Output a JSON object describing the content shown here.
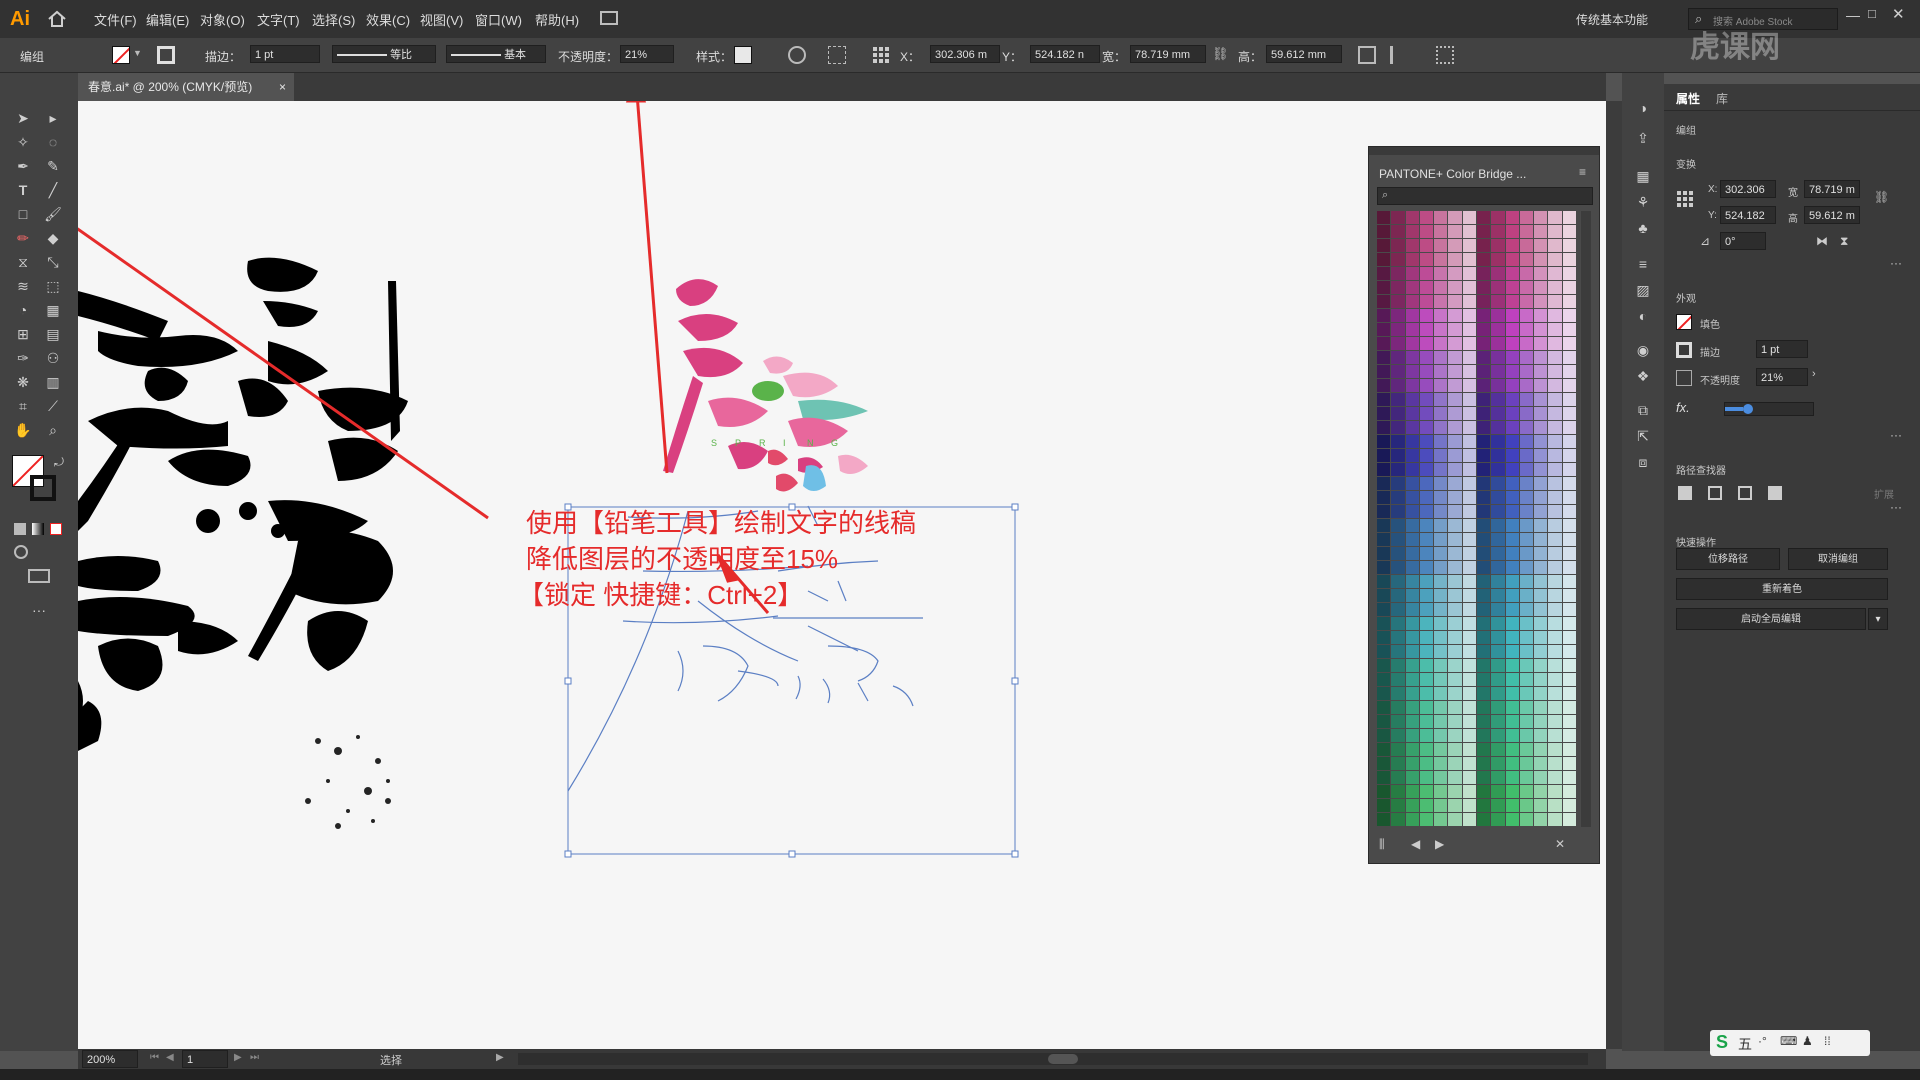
{
  "app": {
    "logo": "Ai",
    "workspace": "传统基本功能",
    "search_placeholder": "搜索 Adobe Stock"
  },
  "menu": [
    "文件(F)",
    "编辑(E)",
    "对象(O)",
    "文字(T)",
    "选择(S)",
    "效果(C)",
    "视图(V)",
    "窗口(W)",
    "帮助(H)"
  ],
  "control_bar": {
    "mode": "编组",
    "stroke_label": "描边：",
    "stroke_value": "1 pt",
    "profile_label": "等比",
    "brush_label": "基本",
    "opacity_label": "不透明度：",
    "opacity_value": "21%",
    "style_label": "样式：",
    "x_label": "X：",
    "x_value": "302.306 m",
    "y_label": "Y：",
    "y_value": "524.182 n",
    "w_label": "宽：",
    "w_value": "78.719 mm",
    "h_label": "高：",
    "h_value": "59.612 mm"
  },
  "document_tab": {
    "label": "春意.ai* @ 200% (CMYK/预览)",
    "close": "×"
  },
  "annotation": {
    "line1": "使用【铅笔工具】绘制文字的线稿",
    "line2": "降低图层的不透明度至15%",
    "line3": "【锁定 快捷键：Ctrl+2】",
    "color": "#e52b2b"
  },
  "artwork": {
    "spring_letters": [
      "S",
      "P",
      "R",
      "I",
      "N",
      "G"
    ]
  },
  "pantone_panel": {
    "title": "PANTONE+ Color Bridge ...",
    "menu_icon": "≡"
  },
  "properties": {
    "tabs": [
      "属性",
      "库"
    ],
    "group_label": "编组",
    "transform_title": "变换",
    "x_label": "X:",
    "x_value": "302.306",
    "y_label": "Y:",
    "y_value": "524.182",
    "w_label": "宽",
    "w_value": "78.719 m",
    "h_label": "高",
    "h_value": "59.612 m",
    "angle_value": "0°",
    "appearance_title": "外观",
    "fill_label": "填色",
    "stroke_label": "描边",
    "stroke_value": "1 pt",
    "opacity_label": "不透明度",
    "opacity_value": "21%",
    "opacity_fraction": 0.21,
    "fx_label": "fx.",
    "pathfinder_title": "路径查找器",
    "pathfinder_more": "扩展",
    "quick_actions_title": "快速操作",
    "btn_offset_path": "位移路径",
    "btn_ungroup": "取消编组",
    "btn_recolor": "重新着色",
    "btn_global_edit": "启动全局编辑"
  },
  "status_bar": {
    "zoom": "200%",
    "page": "1",
    "tool": "选择"
  },
  "ime": {
    "label": "五"
  },
  "watermark": "虎课网"
}
